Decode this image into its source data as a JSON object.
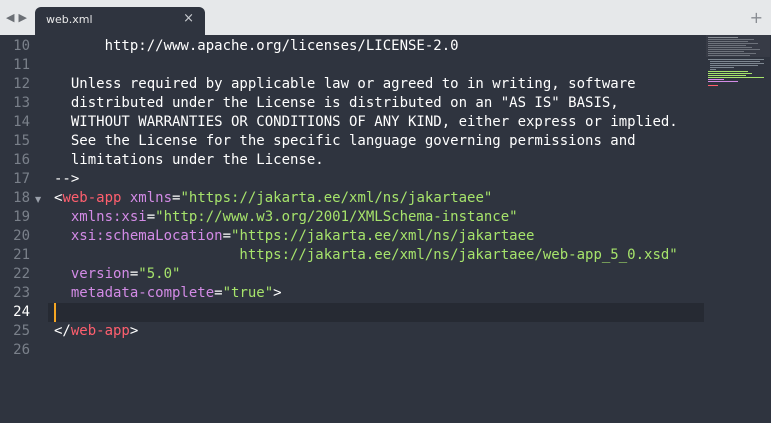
{
  "tabbar": {
    "back_glyph": "◀",
    "forward_glyph": "▶",
    "tab_title": "web.xml",
    "close_glyph": "×",
    "new_tab_glyph": "+"
  },
  "editor": {
    "current_line": 24,
    "lines": [
      {
        "n": "10",
        "segments": [
          {
            "t": "      http://www.apache.org/licenses/LICENSE-2.0",
            "c": "cmt"
          }
        ]
      },
      {
        "n": "11",
        "segments": []
      },
      {
        "n": "12",
        "segments": [
          {
            "t": "  Unless required by applicable law or agreed to in writing, software",
            "c": "cmt"
          }
        ]
      },
      {
        "n": "13",
        "segments": [
          {
            "t": "  distributed under the License is distributed on an \"AS IS\" BASIS,",
            "c": "cmt"
          }
        ]
      },
      {
        "n": "14",
        "segments": [
          {
            "t": "  WITHOUT WARRANTIES OR CONDITIONS OF ANY KIND, either express or implied.",
            "c": "cmt"
          }
        ]
      },
      {
        "n": "15",
        "segments": [
          {
            "t": "  See the License for the specific language governing permissions and",
            "c": "cmt"
          }
        ]
      },
      {
        "n": "16",
        "segments": [
          {
            "t": "  limitations under the License.",
            "c": "cmt"
          }
        ]
      },
      {
        "n": "17",
        "segments": [
          {
            "t": "-->",
            "c": "cmt"
          }
        ]
      },
      {
        "n": "18",
        "fold": true,
        "segments": [
          {
            "t": "<",
            "c": "punc"
          },
          {
            "t": "web-app",
            "c": "tag"
          },
          {
            "t": " xmlns",
            "c": "attr"
          },
          {
            "t": "=",
            "c": "punc"
          },
          {
            "t": "\"https://jakarta.ee/xml/ns/jakartaee\"",
            "c": "str"
          }
        ]
      },
      {
        "n": "19",
        "segments": [
          {
            "t": "  xmlns:xsi",
            "c": "attr"
          },
          {
            "t": "=",
            "c": "punc"
          },
          {
            "t": "\"http://www.w3.org/2001/XMLSchema-instance\"",
            "c": "str"
          }
        ]
      },
      {
        "n": "20",
        "segments": [
          {
            "t": "  xsi:schemaLocation",
            "c": "attr"
          },
          {
            "t": "=",
            "c": "punc"
          },
          {
            "t": "\"https://jakarta.ee/xml/ns/jakartaee",
            "c": "str"
          }
        ]
      },
      {
        "n": "21",
        "segments": [
          {
            "t": "                      https://jakarta.ee/xml/ns/jakartaee/web-app_5_0.xsd\"",
            "c": "str"
          }
        ]
      },
      {
        "n": "22",
        "segments": [
          {
            "t": "  version",
            "c": "attr"
          },
          {
            "t": "=",
            "c": "punc"
          },
          {
            "t": "\"5.0\"",
            "c": "str"
          }
        ]
      },
      {
        "n": "23",
        "segments": [
          {
            "t": "  metadata-complete",
            "c": "attr"
          },
          {
            "t": "=",
            "c": "punc"
          },
          {
            "t": "\"true\"",
            "c": "str"
          },
          {
            "t": ">",
            "c": "punc"
          }
        ]
      },
      {
        "n": "24",
        "segments": []
      },
      {
        "n": "25",
        "segments": [
          {
            "t": "</",
            "c": "punc"
          },
          {
            "t": "web-app",
            "c": "tag"
          },
          {
            "t": ">",
            "c": "punc"
          }
        ]
      },
      {
        "n": "26",
        "segments": []
      }
    ]
  },
  "colors": {
    "background": "#2f343f",
    "tag": "#ff5f6e",
    "attribute": "#d38be6",
    "string": "#a6e36b",
    "caret": "#f5a623"
  }
}
